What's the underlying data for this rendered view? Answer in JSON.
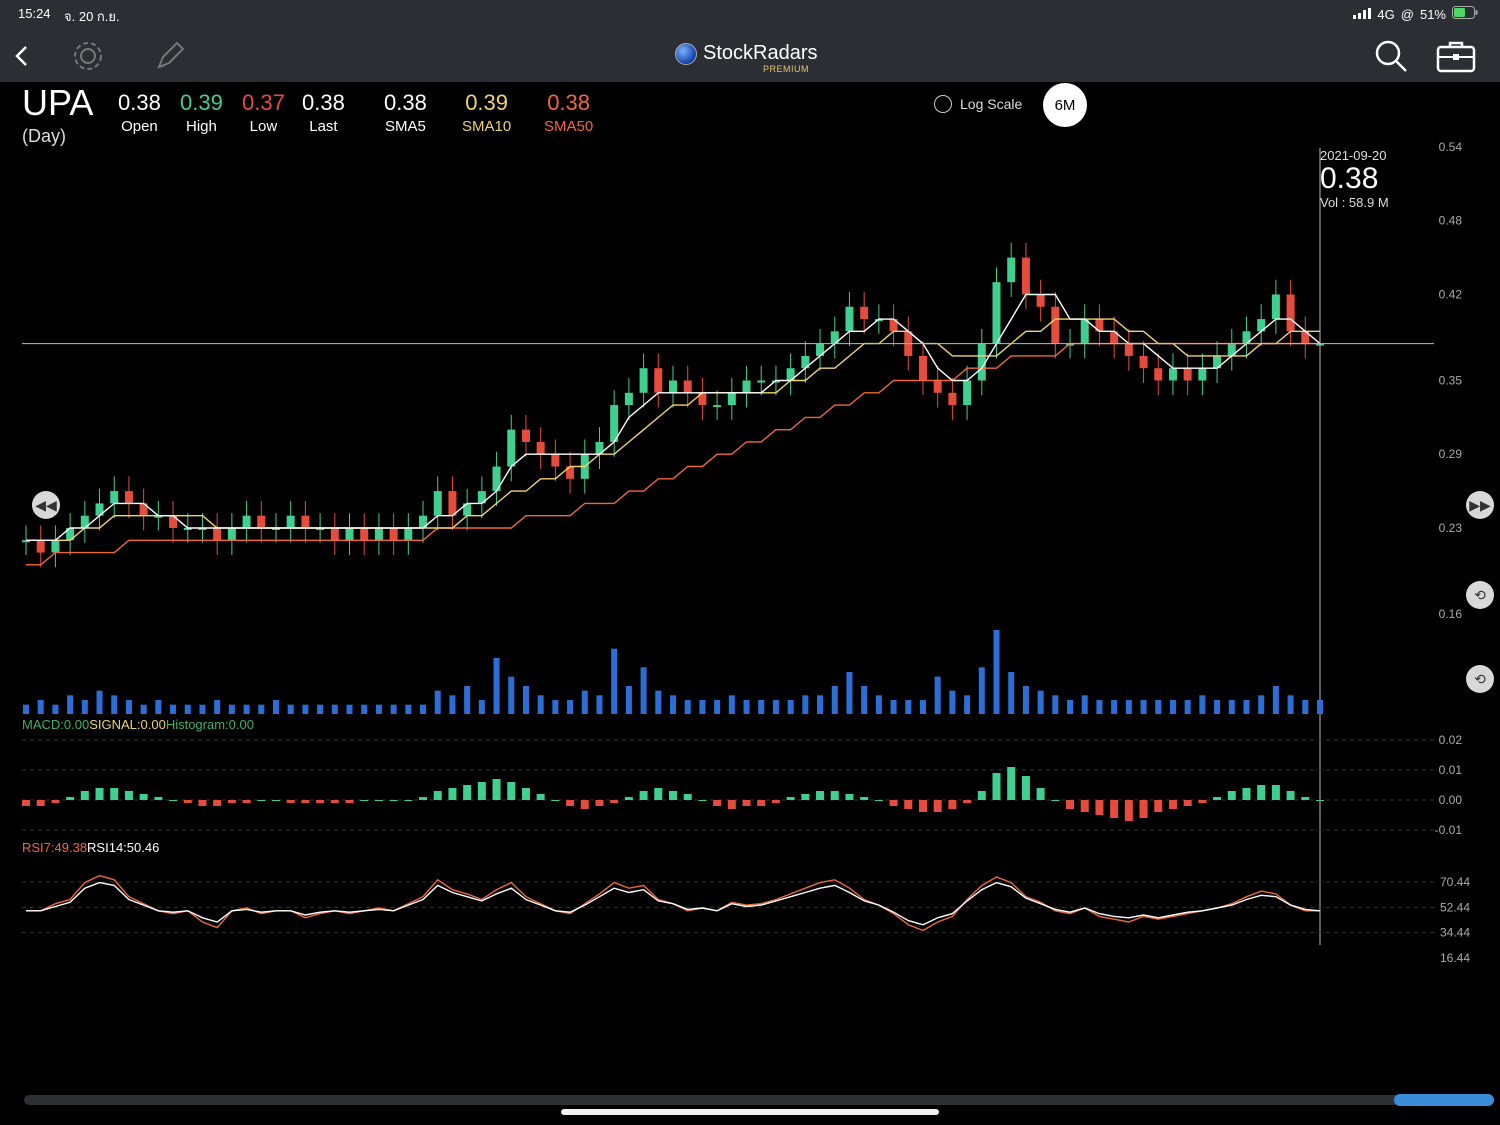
{
  "status": {
    "time": "15:24",
    "date": "จ. 20 ก.ย.",
    "network": "4G",
    "battery": "51%"
  },
  "nav": {
    "brand": "StockRadars",
    "tier": "PREMIUM"
  },
  "quote": {
    "symbol": "UPA",
    "period": "(Day)",
    "open": {
      "value": "0.38",
      "label": "Open",
      "color": "#ffffff"
    },
    "high": {
      "value": "0.39",
      "label": "High",
      "color": "#3fcf8e"
    },
    "low": {
      "value": "0.37",
      "label": "Low",
      "color": "#e64c3c"
    },
    "last": {
      "value": "0.38",
      "label": "Last",
      "color": "#ffffff"
    },
    "sma5": {
      "value": "0.38",
      "label": "SMA5",
      "color": "#ffffff"
    },
    "sma10": {
      "value": "0.39",
      "label": "SMA10",
      "color": "#f2d46b"
    },
    "sma50": {
      "value": "0.38",
      "label": "SMA50",
      "color": "#f0683a"
    }
  },
  "controls": {
    "log_scale": "Log Scale",
    "range": "6M"
  },
  "crosshair": {
    "date": "2021-09-20",
    "price": "0.38",
    "volume_label": "Vol",
    "volume": ": 58.9 M"
  },
  "macd_label": {
    "macd": "MACD:0.00",
    "signal": "SIGNAL:0.00",
    "hist": "Histogram:0.00"
  },
  "rsi_label": {
    "rsi7": "RSI7:49.38",
    "rsi14": "RSI14:50.46"
  },
  "chart_data": {
    "type": "candlestick",
    "price_axis": {
      "ticks": [
        "0.54",
        "0.48",
        "0.42",
        "0.35",
        "0.29",
        "0.23",
        "0.16"
      ],
      "range": [
        0.16,
        0.54
      ]
    },
    "macd_axis": {
      "ticks": [
        "0.02",
        "0.01",
        "0.00",
        "-0.01"
      ]
    },
    "rsi_axis": {
      "ticks": [
        "70.44",
        "52.44",
        "34.44",
        "16.44"
      ]
    },
    "close_series": [
      0.22,
      0.21,
      0.22,
      0.23,
      0.24,
      0.25,
      0.26,
      0.25,
      0.24,
      0.24,
      0.23,
      0.23,
      0.23,
      0.22,
      0.23,
      0.24,
      0.23,
      0.23,
      0.24,
      0.23,
      0.23,
      0.22,
      0.23,
      0.22,
      0.23,
      0.22,
      0.23,
      0.24,
      0.26,
      0.24,
      0.25,
      0.26,
      0.28,
      0.31,
      0.3,
      0.29,
      0.28,
      0.27,
      0.29,
      0.3,
      0.33,
      0.34,
      0.36,
      0.34,
      0.35,
      0.34,
      0.33,
      0.33,
      0.34,
      0.35,
      0.35,
      0.35,
      0.36,
      0.37,
      0.38,
      0.39,
      0.41,
      0.4,
      0.4,
      0.39,
      0.37,
      0.35,
      0.34,
      0.33,
      0.35,
      0.38,
      0.43,
      0.45,
      0.42,
      0.41,
      0.38,
      0.38,
      0.4,
      0.39,
      0.38,
      0.37,
      0.36,
      0.35,
      0.36,
      0.35,
      0.36,
      0.37,
      0.38,
      0.39,
      0.4,
      0.42,
      0.39,
      0.38,
      0.38
    ],
    "sma5": [
      0.22,
      0.22,
      0.22,
      0.23,
      0.23,
      0.24,
      0.25,
      0.25,
      0.25,
      0.24,
      0.24,
      0.23,
      0.23,
      0.23,
      0.23,
      0.23,
      0.23,
      0.23,
      0.23,
      0.23,
      0.23,
      0.23,
      0.23,
      0.23,
      0.23,
      0.23,
      0.23,
      0.23,
      0.24,
      0.24,
      0.25,
      0.25,
      0.26,
      0.28,
      0.29,
      0.29,
      0.29,
      0.29,
      0.29,
      0.29,
      0.3,
      0.32,
      0.33,
      0.34,
      0.34,
      0.34,
      0.34,
      0.34,
      0.34,
      0.34,
      0.34,
      0.35,
      0.35,
      0.36,
      0.37,
      0.38,
      0.39,
      0.39,
      0.4,
      0.4,
      0.39,
      0.38,
      0.36,
      0.35,
      0.35,
      0.36,
      0.38,
      0.4,
      0.42,
      0.42,
      0.42,
      0.4,
      0.4,
      0.39,
      0.39,
      0.38,
      0.38,
      0.37,
      0.36,
      0.36,
      0.36,
      0.36,
      0.37,
      0.38,
      0.39,
      0.4,
      0.4,
      0.39,
      0.38
    ],
    "sma10": [
      0.22,
      0.22,
      0.22,
      0.22,
      0.23,
      0.23,
      0.24,
      0.24,
      0.24,
      0.24,
      0.24,
      0.24,
      0.24,
      0.23,
      0.23,
      0.23,
      0.23,
      0.23,
      0.23,
      0.23,
      0.23,
      0.23,
      0.23,
      0.23,
      0.23,
      0.23,
      0.23,
      0.23,
      0.23,
      0.23,
      0.24,
      0.24,
      0.25,
      0.26,
      0.26,
      0.27,
      0.27,
      0.28,
      0.28,
      0.29,
      0.29,
      0.3,
      0.31,
      0.32,
      0.33,
      0.33,
      0.34,
      0.34,
      0.34,
      0.34,
      0.34,
      0.34,
      0.35,
      0.35,
      0.36,
      0.36,
      0.37,
      0.38,
      0.38,
      0.39,
      0.39,
      0.38,
      0.38,
      0.37,
      0.37,
      0.37,
      0.37,
      0.38,
      0.39,
      0.39,
      0.4,
      0.4,
      0.4,
      0.4,
      0.4,
      0.39,
      0.39,
      0.38,
      0.38,
      0.37,
      0.37,
      0.37,
      0.37,
      0.37,
      0.38,
      0.38,
      0.39,
      0.39,
      0.39
    ],
    "sma50": [
      0.2,
      0.2,
      0.21,
      0.21,
      0.21,
      0.21,
      0.21,
      0.22,
      0.22,
      0.22,
      0.22,
      0.22,
      0.22,
      0.22,
      0.22,
      0.22,
      0.22,
      0.22,
      0.22,
      0.22,
      0.22,
      0.22,
      0.22,
      0.22,
      0.22,
      0.22,
      0.22,
      0.22,
      0.23,
      0.23,
      0.23,
      0.23,
      0.23,
      0.23,
      0.24,
      0.24,
      0.24,
      0.24,
      0.25,
      0.25,
      0.25,
      0.26,
      0.26,
      0.27,
      0.27,
      0.28,
      0.28,
      0.29,
      0.29,
      0.3,
      0.3,
      0.31,
      0.31,
      0.32,
      0.32,
      0.33,
      0.33,
      0.34,
      0.34,
      0.35,
      0.35,
      0.35,
      0.35,
      0.35,
      0.36,
      0.36,
      0.36,
      0.37,
      0.37,
      0.37,
      0.37,
      0.38,
      0.38,
      0.38,
      0.38,
      0.38,
      0.38,
      0.38,
      0.38,
      0.38,
      0.38,
      0.38,
      0.38,
      0.38,
      0.38,
      0.38,
      0.38,
      0.38,
      0.38
    ],
    "volume": [
      2,
      3,
      2,
      4,
      3,
      5,
      4,
      3,
      2,
      3,
      2,
      2,
      2,
      3,
      2,
      2,
      2,
      3,
      2,
      2,
      2,
      2,
      2,
      2,
      2,
      2,
      2,
      2,
      5,
      4,
      6,
      3,
      12,
      8,
      6,
      4,
      3,
      3,
      5,
      4,
      14,
      6,
      10,
      5,
      4,
      3,
      3,
      3,
      4,
      3,
      3,
      3,
      3,
      4,
      4,
      6,
      9,
      6,
      4,
      3,
      3,
      3,
      8,
      5,
      4,
      10,
      18,
      9,
      6,
      5,
      4,
      3,
      4,
      3,
      3,
      3,
      3,
      3,
      3,
      3,
      4,
      3,
      3,
      3,
      4,
      6,
      4,
      3,
      3
    ],
    "macd_hist": [
      -0.002,
      -0.002,
      -0.001,
      0.001,
      0.003,
      0.004,
      0.004,
      0.003,
      0.002,
      0.001,
      0,
      -0.001,
      -0.002,
      -0.002,
      -0.001,
      -0.001,
      0,
      0,
      -0.001,
      -0.001,
      -0.001,
      -0.001,
      -0.001,
      0,
      0,
      0,
      0,
      0.001,
      0.003,
      0.004,
      0.005,
      0.006,
      0.007,
      0.006,
      0.004,
      0.002,
      0,
      -0.002,
      -0.003,
      -0.002,
      -0.001,
      0.001,
      0.003,
      0.004,
      0.003,
      0.002,
      0,
      -0.002,
      -0.003,
      -0.002,
      -0.002,
      -0.001,
      0.001,
      0.002,
      0.003,
      0.003,
      0.002,
      0.001,
      0,
      -0.002,
      -0.003,
      -0.004,
      -0.004,
      -0.003,
      -0.001,
      0.003,
      0.009,
      0.011,
      0.008,
      0.004,
      0,
      -0.003,
      -0.004,
      -0.005,
      -0.006,
      -0.007,
      -0.006,
      -0.004,
      -0.003,
      -0.002,
      -0.001,
      0.001,
      0.003,
      0.004,
      0.005,
      0.005,
      0.003,
      0.001,
      0
    ],
    "rsi7": [
      50,
      50,
      55,
      58,
      70,
      75,
      72,
      60,
      55,
      50,
      48,
      50,
      42,
      38,
      50,
      52,
      48,
      50,
      50,
      45,
      48,
      50,
      48,
      50,
      52,
      50,
      55,
      60,
      72,
      65,
      62,
      58,
      65,
      70,
      60,
      55,
      50,
      48,
      55,
      62,
      70,
      66,
      68,
      58,
      55,
      50,
      52,
      50,
      56,
      54,
      55,
      58,
      62,
      66,
      70,
      72,
      66,
      58,
      54,
      48,
      40,
      36,
      42,
      46,
      58,
      68,
      74,
      70,
      60,
      56,
      50,
      48,
      52,
      46,
      44,
      42,
      46,
      44,
      46,
      48,
      50,
      52,
      55,
      60,
      64,
      62,
      54,
      50,
      50
    ],
    "rsi14": [
      50,
      50,
      53,
      56,
      66,
      70,
      68,
      58,
      54,
      50,
      49,
      50,
      45,
      42,
      50,
      51,
      49,
      50,
      50,
      47,
      49,
      50,
      49,
      50,
      51,
      50,
      54,
      58,
      68,
      63,
      60,
      57,
      62,
      66,
      58,
      54,
      50,
      49,
      54,
      60,
      66,
      63,
      65,
      57,
      55,
      51,
      52,
      50,
      55,
      53,
      54,
      57,
      60,
      63,
      66,
      68,
      63,
      57,
      54,
      49,
      43,
      40,
      45,
      48,
      57,
      65,
      70,
      67,
      59,
      55,
      51,
      49,
      52,
      48,
      46,
      45,
      47,
      45,
      47,
      49,
      50,
      52,
      54,
      58,
      61,
      60,
      54,
      51,
      50
    ]
  }
}
